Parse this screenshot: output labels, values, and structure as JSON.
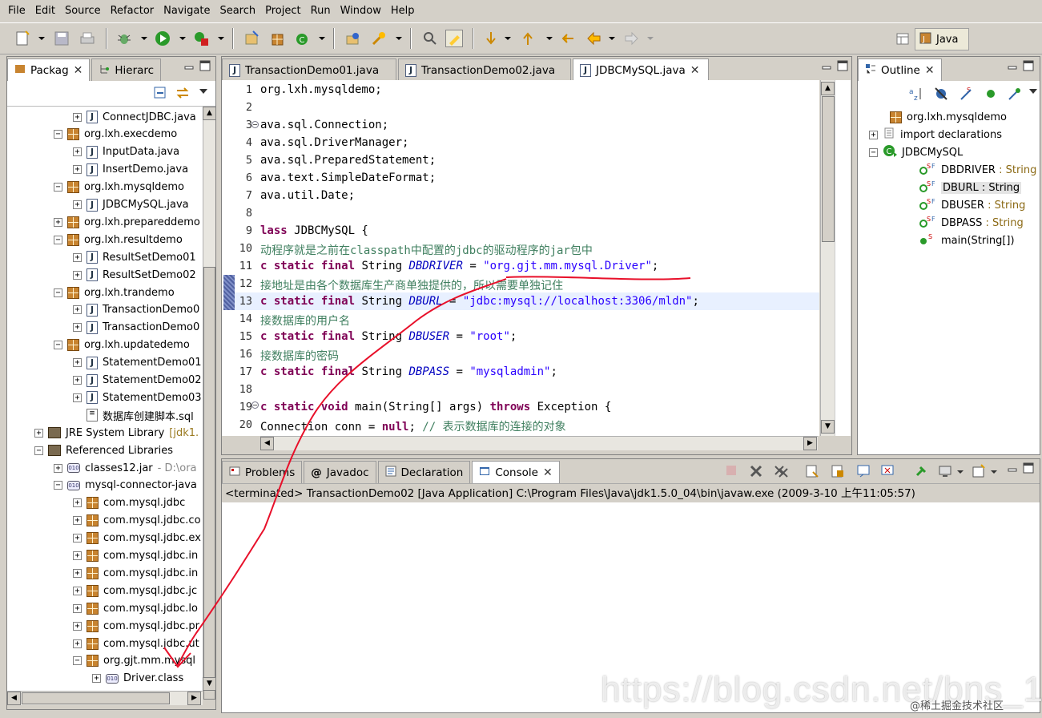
{
  "menu": [
    "File",
    "Edit",
    "Source",
    "Refactor",
    "Navigate",
    "Search",
    "Project",
    "Run",
    "Window",
    "Help"
  ],
  "perspective": {
    "label": "Java"
  },
  "left_panel": {
    "tabs": [
      {
        "label": "Packag"
      },
      {
        "label": "Hierarc"
      }
    ],
    "tree": [
      {
        "label": "ConnectJDBC.java",
        "icon": "java-file",
        "indent": 3
      },
      {
        "label": "org.lxh.execdemo",
        "icon": "package",
        "indent": 2
      },
      {
        "label": "InputData.java",
        "icon": "java-file",
        "indent": 3
      },
      {
        "label": "InsertDemo.java",
        "icon": "java-file",
        "indent": 3
      },
      {
        "label": "org.lxh.mysqldemo",
        "icon": "package",
        "indent": 2
      },
      {
        "label": "JDBCMySQL.java",
        "icon": "java-file",
        "indent": 3
      },
      {
        "label": "org.lxh.prepareddemo",
        "icon": "package",
        "indent": 2
      },
      {
        "label": "org.lxh.resultdemo",
        "icon": "package",
        "indent": 2
      },
      {
        "label": "ResultSetDemo01",
        "icon": "java-file",
        "indent": 3
      },
      {
        "label": "ResultSetDemo02",
        "icon": "java-file",
        "indent": 3
      },
      {
        "label": "org.lxh.trandemo",
        "icon": "package",
        "indent": 2
      },
      {
        "label": "TransactionDemo0",
        "icon": "java-file",
        "indent": 3
      },
      {
        "label": "TransactionDemo0",
        "icon": "java-file",
        "indent": 3
      },
      {
        "label": "org.lxh.updatedemo",
        "icon": "package",
        "indent": 2
      },
      {
        "label": "StatementDemo01",
        "icon": "java-file",
        "indent": 3
      },
      {
        "label": "StatementDemo02",
        "icon": "java-file",
        "indent": 3
      },
      {
        "label": "StatementDemo03",
        "icon": "java-file",
        "indent": 3
      },
      {
        "label": "数据库创建脚本.sql",
        "icon": "sql-file",
        "indent": 3
      },
      {
        "label": "JRE System Library",
        "suffix": "[jdk1.",
        "icon": "library",
        "indent": 1
      },
      {
        "label": "Referenced Libraries",
        "icon": "library",
        "indent": 1
      },
      {
        "label": "classes12.jar",
        "suffix": "- D:\\ora",
        "icon": "jar",
        "indent": 2
      },
      {
        "label": "mysql-connector-java",
        "icon": "jar",
        "indent": 2
      },
      {
        "label": "com.mysql.jdbc",
        "icon": "package",
        "indent": 3
      },
      {
        "label": "com.mysql.jdbc.co",
        "icon": "package",
        "indent": 3
      },
      {
        "label": "com.mysql.jdbc.ex",
        "icon": "package",
        "indent": 3
      },
      {
        "label": "com.mysql.jdbc.in",
        "icon": "package",
        "indent": 3
      },
      {
        "label": "com.mysql.jdbc.in",
        "icon": "package",
        "indent": 3
      },
      {
        "label": "com.mysql.jdbc.jc",
        "icon": "package",
        "indent": 3
      },
      {
        "label": "com.mysql.jdbc.lo",
        "icon": "package",
        "indent": 3
      },
      {
        "label": "com.mysql.jdbc.pr",
        "icon": "package",
        "indent": 3
      },
      {
        "label": "com.mysql.jdbc.ut",
        "icon": "package",
        "indent": 3
      },
      {
        "label": "org.gjt.mm.mysql",
        "icon": "package",
        "indent": 3
      },
      {
        "label": "Driver.class",
        "icon": "class-file",
        "indent": 4
      }
    ]
  },
  "editor": {
    "tabs": [
      {
        "label": "TransactionDemo01.java"
      },
      {
        "label": "TransactionDemo02.java"
      },
      {
        "label": "JDBCMySQL.java"
      }
    ],
    "line_numbers": [
      "1",
      "2",
      "3",
      "4",
      "5",
      "6",
      "7",
      "8",
      "9",
      "10",
      "11",
      "12",
      "13",
      "14",
      "15",
      "16",
      "17",
      "18",
      "19",
      "20"
    ],
    "lines": {
      "l1": "org.lxh.mysqldemo;",
      "l3": "ava.sql.Connection;",
      "l4": "ava.sql.DriverManager;",
      "l5": "ava.sql.PreparedStatement;",
      "l6": "ava.text.SimpleDateFormat;",
      "l7": "ava.util.Date;",
      "l9_kw": "lass",
      "l9_rest": " JDBCMySQL {",
      "l10": "动程序就是之前在classpath中配置的jdbc的驱动程序的jar包中",
      "l11_kw": "c static final",
      "l11_type": " String ",
      "l11_field": "DBDRIVER",
      "l11_eq": " = ",
      "l11_str": "\"org.gjt.mm.mysql.Driver\"",
      "l11_end": ";",
      "l12": "接地址是由各个数据库生产商单独提供的，所以需要单独记住",
      "l13_kw": "c static final",
      "l13_type": " String ",
      "l13_field": "DBURL",
      "l13_eq": " = ",
      "l13_str": "\"jdbc:mysql://localhost:3306/mldn\"",
      "l13_end": ";",
      "l14": "接数据库的用户名",
      "l15_kw": "c static final",
      "l15_type": " String ",
      "l15_field": "DBUSER",
      "l15_eq": " = ",
      "l15_str": "\"root\"",
      "l15_end": ";",
      "l16": "接数据库的密码",
      "l17_kw": "c static final",
      "l17_type": " String ",
      "l17_field": "DBPASS",
      "l17_eq": " = ",
      "l17_str": "\"mysqladmin\"",
      "l17_end": ";",
      "l19_kw1": "c static void",
      "l19_mid": " main(String[] args) ",
      "l19_kw2": "throws",
      "l19_end": " Exception {",
      "l20_a": "Connection conn = ",
      "l20_kw": "null",
      "l20_b": "; ",
      "l20_cm": "// 表示数据库的连接的对象"
    }
  },
  "outline": {
    "tab": "Outline",
    "items": [
      {
        "label": "org.lxh.mysqldemo",
        "type": ""
      },
      {
        "label": "import declarations",
        "type": ""
      },
      {
        "label": "JDBCMySQL",
        "type": ""
      },
      {
        "label": "DBDRIVER",
        "type": " : String"
      },
      {
        "label": "DBURL",
        "type": " : String"
      },
      {
        "label": "DBUSER",
        "type": " : String"
      },
      {
        "label": "DBPASS",
        "type": " : String"
      },
      {
        "label": "main(String[])",
        "type": ""
      }
    ]
  },
  "bottom": {
    "tabs": [
      {
        "label": "Problems"
      },
      {
        "label": "Javadoc"
      },
      {
        "label": "Declaration"
      },
      {
        "label": "Console"
      }
    ],
    "status": "<terminated> TransactionDemo02 [Java Application] C:\\Program Files\\Java\\jdk1.5.0_04\\bin\\javaw.exe (2009-3-10 上午11:05:57)"
  },
  "watermark": {
    "url": "https://blog.csdn.net/bns_1",
    "site": "@稀土掘金技术社区"
  },
  "colors": {
    "annotation": "#e8102a",
    "keyword": "#7f0055",
    "string": "#2a00ff",
    "comment": "#3f7f5f",
    "field": "#0000c0"
  }
}
